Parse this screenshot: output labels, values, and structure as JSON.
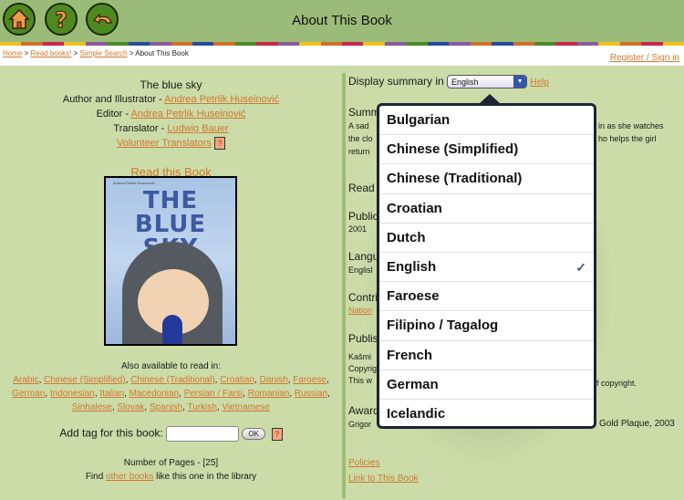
{
  "header": {
    "title": "About This Book",
    "nav_icons": [
      "home-icon",
      "help-icon",
      "back-icon"
    ],
    "stripe_colors": [
      "#f0c020",
      "#d0702a",
      "#c8284a",
      "#f0c020",
      "#8a5aa0",
      "#4a8a2a",
      "#2a4aa0",
      "#8a5aa0",
      "#d0702a",
      "#2a4aa0",
      "#d0702a",
      "#4a8a2a",
      "#c8284a",
      "#8a5aa0",
      "#f0c020",
      "#d0702a",
      "#c8284a",
      "#f0c020",
      "#8a5aa0",
      "#4a8a2a",
      "#2a4aa0",
      "#8a5aa0",
      "#d0702a",
      "#2a4aa0",
      "#d0702a",
      "#4a8a2a",
      "#c8284a",
      "#8a5aa0",
      "#f0c020",
      "#d0702a",
      "#c8284a",
      "#f0c020"
    ]
  },
  "breadcrumb": {
    "items": [
      "Home",
      "Read books!",
      "Simple Search"
    ],
    "current": "About This Book",
    "separator": ">"
  },
  "register_link": "Register / Sign in",
  "book": {
    "title": "The blue sky",
    "author_label": "Author and Illustrator -",
    "author": "Andrea Petrlik Huseinović",
    "editor_label": "Editor -",
    "editor": "Andrea Petrlik Huseinović",
    "translator_label": "Translator -",
    "translator": "Ludwig Bauer",
    "volunteer_link": "Volunteer Translators",
    "help_glyph": "?",
    "read_link": "Read this Book",
    "cover_title": "THE BLUE SKY",
    "cover_author": "Andrea Petrlik Huseinović",
    "available_label": "Also available to read in:",
    "available_languages": [
      "Arabic",
      "Chinese (Simplified)",
      "Chinese (Traditional)",
      "Croatian",
      "Danish",
      "Faroese",
      "German",
      "Indonesian",
      "Italian",
      "Macedonian",
      "Persian / Farsi",
      "Romanian",
      "Russian",
      "Sinhalese",
      "Slovak",
      "Spanish",
      "Turkish",
      "Vietnamese"
    ],
    "tag_label": "Add tag for this book:",
    "tag_value": "",
    "ok_label": "OK",
    "pages_text": "Number of Pages - [25]",
    "find_prefix": "Find",
    "find_link": "other books",
    "find_suffix": "like this one in the library"
  },
  "right": {
    "display_label": "Display summary in",
    "selected_language": "English",
    "help_link": "Help",
    "summary_heading": "Summ",
    "summary_lines": [
      "A sad",
      "the clo",
      "return"
    ],
    "summary_right_lines": [
      "in as she watches",
      "ho helps the girl"
    ],
    "read_heading": "Read",
    "published_heading": "Public",
    "published_value": "2001",
    "language_heading": "Langu",
    "language_value": "Englisl",
    "contributor_heading": "Contri",
    "contributor_value": "Nation",
    "publisher_heading": "Publis",
    "publisher_lines": [
      "Kašmi",
      "Copyrig",
      "This w"
    ],
    "publisher_right": "f copyright.",
    "award_heading": "Award",
    "award_left": "Grigor",
    "award_right": "Gold Plaque, 2003",
    "policies_link": "Policies",
    "link_to_book": "Link to This Book"
  },
  "dropdown": {
    "options": [
      "Bulgarian",
      "Chinese (Simplified)",
      "Chinese (Traditional)",
      "Croatian",
      "Dutch",
      "English",
      "Faroese",
      "Filipino / Tagalog",
      "French",
      "German",
      "Icelandic"
    ],
    "selected": "English",
    "check_glyph": "✓"
  }
}
